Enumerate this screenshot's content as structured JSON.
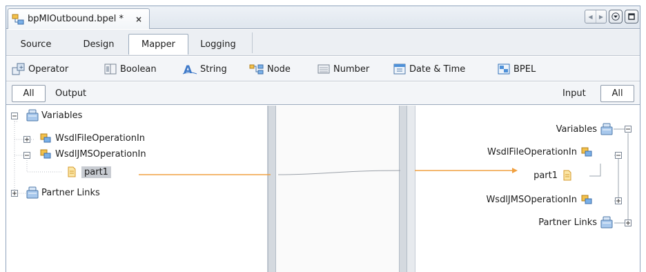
{
  "editor_tab": {
    "title": "bpMIOutbound.bpel *",
    "close": "×"
  },
  "window_controls": {
    "prev": "◀",
    "next": "▶"
  },
  "views": [
    "Source",
    "Design",
    "Mapper",
    "Logging"
  ],
  "active_view": "Mapper",
  "palette": [
    "Operator",
    "Boolean",
    "String",
    "Node",
    "Number",
    "Date & Time",
    "BPEL"
  ],
  "output_header": {
    "filter": "All",
    "label": "Output"
  },
  "input_header": {
    "label": "Input",
    "filter": "All"
  },
  "output_tree": {
    "variables": "Variables",
    "file_op": "WsdlFileOperationIn",
    "jms_op": "WsdlJMSOperationIn",
    "part": "part1",
    "partner_links": "Partner Links"
  },
  "input_tree": {
    "variables": "Variables",
    "file_op": "WsdlFileOperationIn",
    "part": "part1",
    "jms_op": "WsdlJMSOperationIn",
    "partner_links": "Partner Links"
  },
  "colors": {
    "link": "#f0a040",
    "selection": "#c8ccd2",
    "accent": "#3c78c8"
  }
}
